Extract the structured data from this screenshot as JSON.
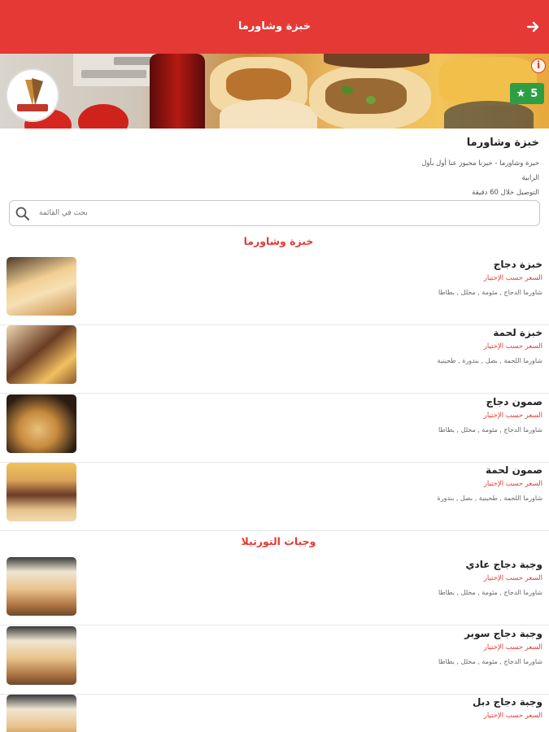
{
  "header": {
    "title": "خبزة وشاورما",
    "back_icon": "arrow-right-icon",
    "color": "#e53935"
  },
  "banner": {
    "logo_icon": "restaurant-logo",
    "info_icon": "info-icon",
    "rating": "5",
    "rating_icon": "star-icon",
    "rating_color": "#2e9e45"
  },
  "restaurant": {
    "name": "خبزة وشاورما",
    "description": "خبزة وشاورما - خبزنا مخبوز عنا أول بأول الرابية",
    "delivery": "التوصيل خلال 60 دقيقة"
  },
  "search": {
    "placeholder": "بحث في القائمة",
    "icon": "search-icon"
  },
  "sections": [
    {
      "title": "خبزة وشاورما",
      "items": [
        {
          "name": "خبزة دجاج",
          "price": "السعر حسب الإختيار",
          "description": "شاورما الدجاج , مثومة , مخلل , بطاطا"
        },
        {
          "name": "خبزة لحمة",
          "price": "السعر حسب الإختيار",
          "description": "شاورما اللحمة , بصل , بندورة , طحينية"
        },
        {
          "name": "صمون دجاج",
          "price": "السعر حسب الإختيار",
          "description": "شاورما الدجاج , مثومة , مخلل , بطاطا"
        },
        {
          "name": "صمون لحمة",
          "price": "السعر حسب الإختيار",
          "description": "شاورما اللحمة , طحينية , بصل , بندورة"
        }
      ]
    },
    {
      "title": "وجبات التورتيلا",
      "items": [
        {
          "name": "وجبة دجاج عادي",
          "price": "السعر حسب الإختيار",
          "description": "شاورما الدجاج , مثومة , مخلل , بطاطا"
        },
        {
          "name": "وجبة دجاج سوبر",
          "price": "السعر حسب الإختيار",
          "description": "شاورما الدجاج , مثومة , مخلل , بطاطا"
        },
        {
          "name": "وجبة دجاج دبل",
          "price": "السعر حسب الإختيار",
          "description": ""
        }
      ]
    }
  ]
}
